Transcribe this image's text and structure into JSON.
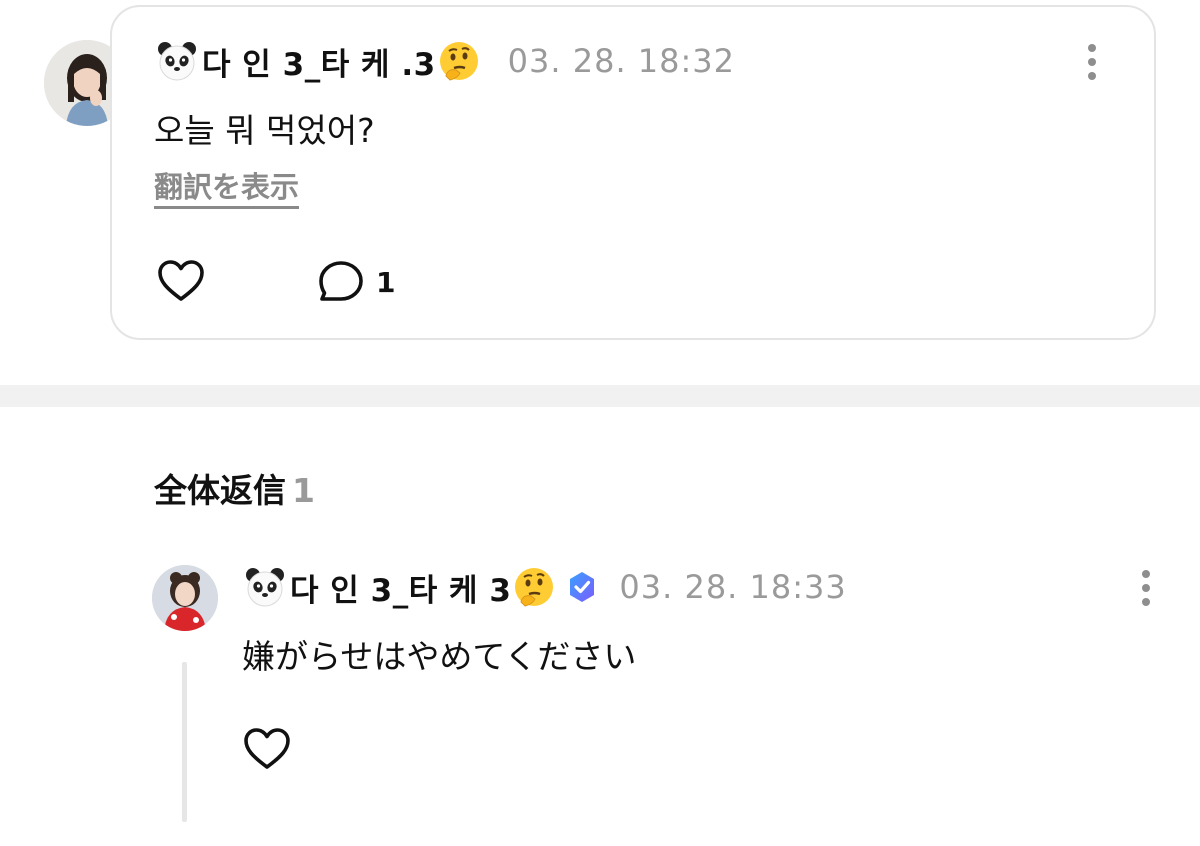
{
  "post": {
    "avatar_icon": "user-avatar-photo",
    "username": "다 인 3_타 케 .3",
    "username_prefix_icon": "panda-emoji-icon",
    "username_suffix_icon": "thinking-face-emoji-icon",
    "timestamp": "03. 28. 18:32",
    "more_icon": "more-vertical-icon",
    "body": "오늘 뭐 먹었어?",
    "translate_label": "翻訳を表示",
    "like_icon": "heart-icon",
    "comment_icon": "comment-bubble-icon",
    "comment_count": "1"
  },
  "replies_section": {
    "title": "全体返信",
    "count": "1"
  },
  "reply": {
    "avatar_icon": "user-avatar-photo",
    "username": "다 인 3_타 케 3",
    "username_prefix_icon": "panda-emoji-icon",
    "username_suffix_icon": "thinking-face-emoji-icon",
    "verified_icon": "verified-badge-icon",
    "timestamp": "03. 28. 18:33",
    "more_icon": "more-vertical-icon",
    "body": "嫌がらせはやめてください",
    "like_icon": "heart-icon"
  },
  "colors": {
    "text": "#111111",
    "muted": "#9a9a9a",
    "card_border": "#e4e4e4",
    "divider": "#f1f1f1",
    "verified_start": "#3aa0ff",
    "verified_end": "#7b5cff"
  }
}
